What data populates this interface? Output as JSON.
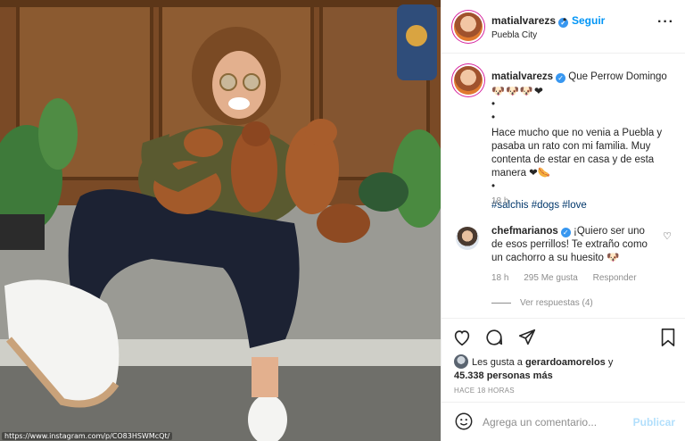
{
  "photo": {
    "watermark": "https://www.instagram.com/p/CO83HSWMcQt/"
  },
  "header": {
    "username": "matialvarezs",
    "separator": "•",
    "follow_label": "Seguir",
    "location": "Puebla City",
    "more_icon": "more-dots-icon"
  },
  "caption": {
    "username": "matialvarezs",
    "title": "Que Perrow Domingo",
    "emojis": "🐶🐶🐶❤",
    "bullet1": "•",
    "bullet2": "•",
    "text": "Hace mucho que no venia a Puebla y pasaba un rato con mi familia. Muy contenta de estar en casa y de esta manera ❤🌭",
    "bullet3": "•",
    "hashtags": "#salchis #dogs #love",
    "time": "18 h"
  },
  "comment": {
    "username": "chefmarianos",
    "text": "¡Quiero ser uno de esos perrillos! Te extraño como un cachorro a su huesito 🐶",
    "time": "18 h",
    "likes": "295 Me gusta",
    "reply_label": "Responder",
    "view_replies": "Ver respuestas (4)"
  },
  "actions": {
    "liked_by_prefix": "Les gusta a",
    "liked_by_user": "gerardoamorelos",
    "liked_by_and": "y",
    "likes_count": "45.338 personas más",
    "ago": "HACE 18 HORAS"
  },
  "add_comment": {
    "placeholder": "Agrega un comentario...",
    "publish_label": "Publicar"
  },
  "colors": {
    "link_blue": "#0095f6",
    "hashtag": "#00376b",
    "muted": "#8e8e8e",
    "verified": "#3897f0"
  }
}
